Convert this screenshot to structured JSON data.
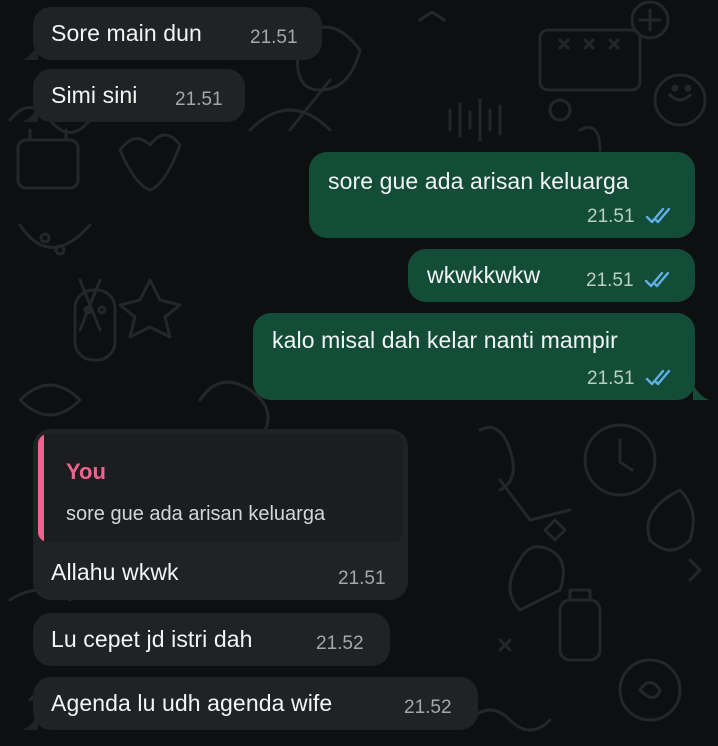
{
  "chat": {
    "messages": [
      {
        "direction": "incoming",
        "text": "Sore main dun",
        "time": "21.51"
      },
      {
        "direction": "incoming",
        "text": "Simi sini",
        "time": "21.51"
      },
      {
        "direction": "outgoing",
        "text": "sore gue ada arisan keluarga",
        "time": "21.51",
        "status_icon": "double-check-icon"
      },
      {
        "direction": "outgoing",
        "text": "wkwkkwkw",
        "time": "21.51",
        "status_icon": "double-check-icon"
      },
      {
        "direction": "outgoing",
        "text": "kalo misal dah kelar nanti mampir",
        "time": "21.51",
        "status_icon": "double-check-icon"
      },
      {
        "direction": "incoming",
        "quoted": {
          "author": "You",
          "text": "sore gue ada arisan keluarga"
        },
        "text": "Allahu wkwk",
        "time": "21.51"
      },
      {
        "direction": "incoming",
        "text": "Lu cepet jd istri dah",
        "time": "21.52"
      },
      {
        "direction": "incoming",
        "text": "Agenda lu udh agenda wife",
        "time": "21.52"
      }
    ]
  },
  "colors": {
    "background": "#0e0f10",
    "incoming_bubble": "#202223",
    "outgoing_bubble": "#134d37",
    "read_ticks": "#5fb0e8",
    "quote_accent": "#f06292"
  }
}
